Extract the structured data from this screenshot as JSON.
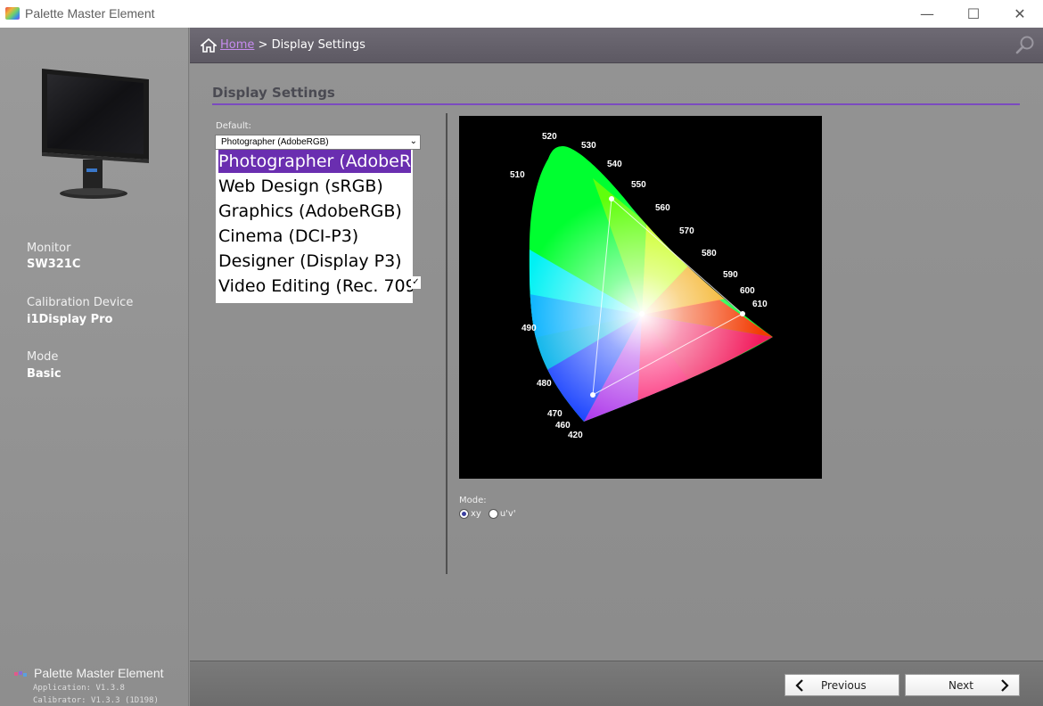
{
  "window": {
    "title": "Palette Master Element",
    "minimize_glyph": "—",
    "maximize_glyph": "☐",
    "close_glyph": "✕"
  },
  "sidebar": {
    "monitor_label": "Monitor",
    "monitor_value": "SW321C",
    "device_label": "Calibration Device",
    "device_value": "i1Display Pro",
    "mode_label": "Mode",
    "mode_value": "Basic",
    "brand_name": "Palette Master Element",
    "app_version": "Application: V1.3.8",
    "calibrator_version": "Calibrator: V1.3.3 (1D198)"
  },
  "header": {
    "home_link": "Home",
    "separator": " > ",
    "current": "Display Settings"
  },
  "main": {
    "section_title": "Display Settings",
    "default_label": "Default:",
    "selected_preset": "Photographer (AdobeRGB)",
    "select_chevron": "⌄",
    "presets": [
      "Photographer (AdobeR",
      "Web Design (sRGB)",
      "Graphics (AdobeRGB)",
      "Cinema (DCI-P3)",
      "Designer (Display P3)",
      "Video Editing (Rec. 709"
    ],
    "dropdown_check": "✓",
    "mode_label": "Mode:",
    "mode_options": [
      "xy",
      "u'v'"
    ],
    "mode_selected": "xy"
  },
  "diagram": {
    "wavelength_labels": [
      "520",
      "530",
      "540",
      "550",
      "560",
      "570",
      "580",
      "590",
      "600",
      "610",
      "510",
      "490",
      "480",
      "470",
      "460",
      "420"
    ]
  },
  "footer": {
    "previous_label": "Previous",
    "next_label": "Next"
  }
}
